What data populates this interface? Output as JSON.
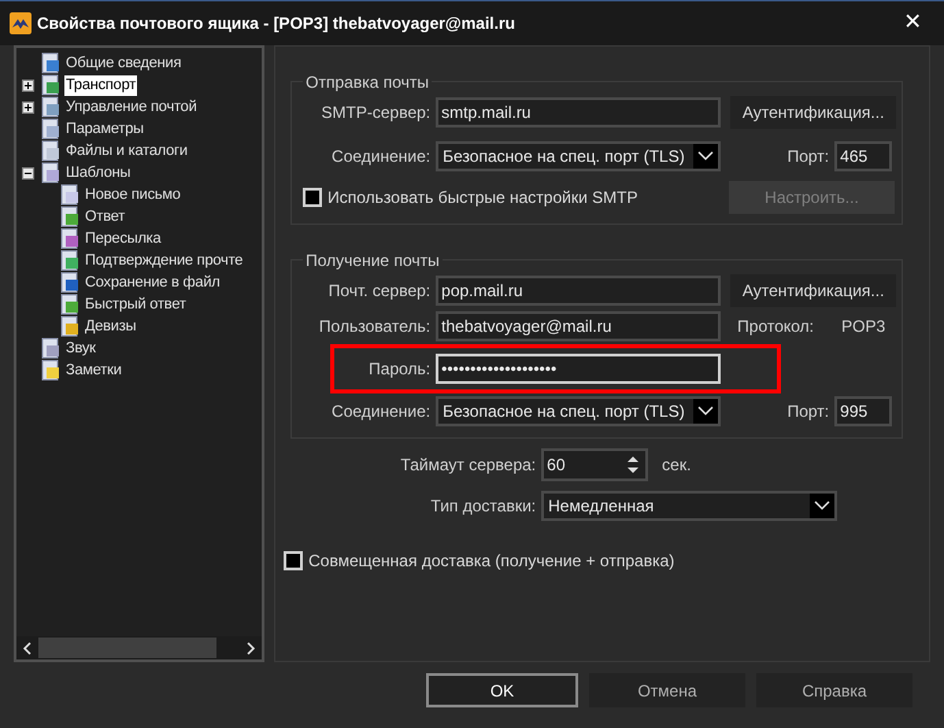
{
  "window": {
    "title": "Свойства почтового ящика - [POP3] thebatvoyager@mail.ru",
    "close": "✕"
  },
  "tree": [
    {
      "label": "Общие сведения",
      "selected": false
    },
    {
      "label": "Транспорт",
      "selected": true,
      "expanded": false
    },
    {
      "label": "Управление почтой",
      "selected": false,
      "expanded": false
    },
    {
      "label": "Параметры",
      "selected": false
    },
    {
      "label": "Файлы и каталоги",
      "selected": false
    },
    {
      "label": "Шаблоны",
      "selected": false,
      "expanded": true,
      "children": [
        {
          "label": "Новое письмо",
          "selected": false
        },
        {
          "label": "Ответ",
          "selected": false
        },
        {
          "label": "Пересылка",
          "selected": false
        },
        {
          "label": "Подтверждение прочте",
          "selected": false
        },
        {
          "label": "Сохранение в файл",
          "selected": false
        },
        {
          "label": "Быстрый ответ",
          "selected": false
        },
        {
          "label": "Девизы",
          "selected": false
        }
      ]
    },
    {
      "label": "Звук",
      "selected": false
    },
    {
      "label": "Заметки",
      "selected": false
    }
  ],
  "sending": {
    "title": "Отправка почты",
    "server_label": "SMTP-сервер:",
    "server": "smtp.mail.ru",
    "auth_button": "Аутентификация...",
    "connection_label": "Соединение:",
    "connection": "Безопасное на спец. порт (TLS)",
    "port_label": "Порт:",
    "port": "465",
    "quick_smtp": {
      "label": "Использовать быстрые настройки SMTP",
      "checked": false
    },
    "configure_button": {
      "label": "Настроить...",
      "disabled": true
    }
  },
  "receiving": {
    "title": "Получение почты",
    "server_label": "Почт. сервер:",
    "server": "pop.mail.ru",
    "auth_button": "Аутентификация...",
    "user_label": "Пользователь:",
    "user": "thebatvoyager@mail.ru",
    "protocol_label": "Протокол:",
    "protocol": "POP3",
    "password_label": "Пароль:",
    "password": "••••••••••••••••••••",
    "password_highlighted": true,
    "connection_label": "Соединение:",
    "connection": "Безопасное на спец. порт (TLS)",
    "port_label": "Порт:",
    "port": "995"
  },
  "timeout": {
    "label": "Таймаут сервера:",
    "value": "60",
    "unit": "сек."
  },
  "delivery": {
    "label": "Тип доставки:",
    "value": "Немедленная"
  },
  "combined_delivery": {
    "label": "Совмещенная доставка (получение + отправка)",
    "checked": false
  },
  "buttons": [
    {
      "label": "OK",
      "default": true
    },
    {
      "label": "Отмена",
      "default": false
    },
    {
      "label": "Справка",
      "default": false
    }
  ]
}
